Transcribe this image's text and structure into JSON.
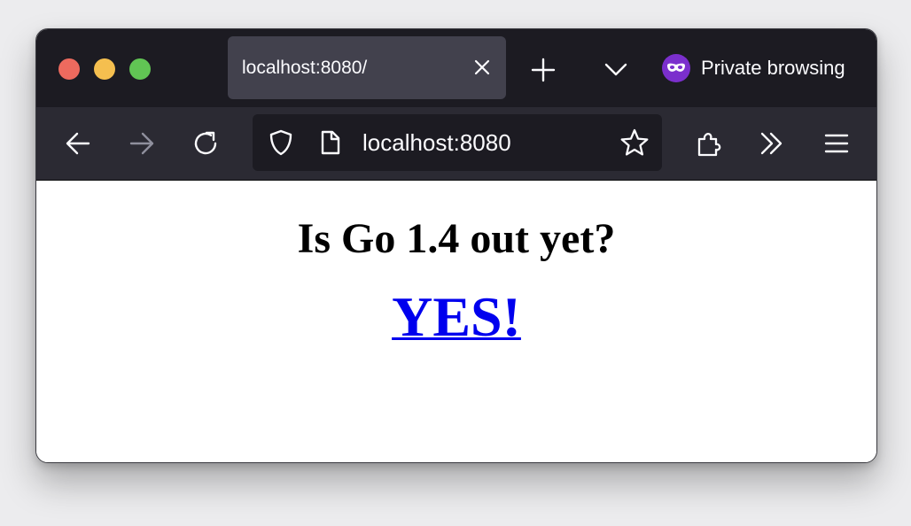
{
  "browser": {
    "tab": {
      "title": "localhost:8080/"
    },
    "private_label": "Private browsing",
    "url": "localhost:8080",
    "icons": {
      "close_window": "close-circle",
      "minimize_window": "minimize-circle",
      "maximize_window": "maximize-circle",
      "tab_close": "close-icon",
      "new_tab": "plus-icon",
      "list_tabs": "chevron-down-icon",
      "private": "mask-icon",
      "back": "arrow-left-icon",
      "forward": "arrow-right-icon",
      "reload": "reload-icon",
      "tracking_protection": "shield-icon",
      "page_info": "page-icon",
      "bookmark": "star-icon",
      "extensions": "puzzle-icon",
      "overflow": "double-chevron-icon",
      "menu": "hamburger-icon"
    },
    "colors": {
      "titlebar": "#1c1b22",
      "tab_active": "#42414d",
      "toolbar": "#2b2a33",
      "private_badge": "#7b2fcd",
      "link": "#0000ee"
    }
  },
  "page": {
    "heading": "Is Go 1.4 out yet?",
    "answer": "YES!"
  }
}
